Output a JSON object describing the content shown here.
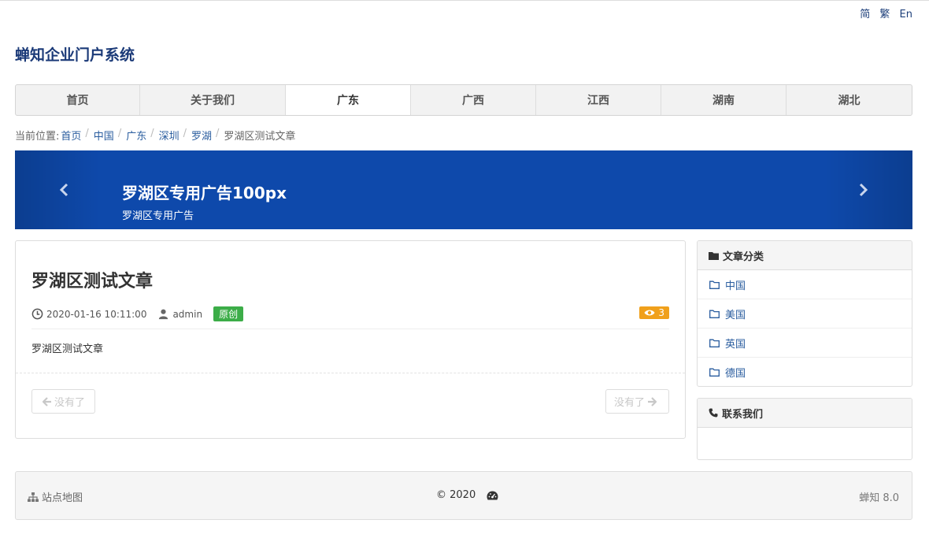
{
  "lang": {
    "simplified": "简",
    "traditional": "繁",
    "english": "En"
  },
  "site": {
    "title": "蝉知企业门户系统"
  },
  "nav": {
    "items": [
      {
        "label": "首页"
      },
      {
        "label": "关于我们"
      },
      {
        "label": "广东",
        "active": true
      },
      {
        "label": "广西"
      },
      {
        "label": "江西"
      },
      {
        "label": "湖南"
      },
      {
        "label": "湖北"
      }
    ]
  },
  "breadcrumb": {
    "prefix": "当前位置:",
    "items": [
      "首页",
      "中国",
      "广东",
      "深圳",
      "罗湖"
    ],
    "current": "罗湖区测试文章"
  },
  "banner": {
    "title": "罗湖区专用广告100px",
    "subtitle": "罗湖区专用广告",
    "bg_color": "#0e49ab",
    "prev_icon": "chevron-left-icon",
    "next_icon": "chevron-right-icon"
  },
  "article": {
    "title": "罗湖区测试文章",
    "date": "2020-01-16 10:11:00",
    "author": "admin",
    "type_badge": "原创",
    "views": "3",
    "body": "罗湖区测试文章",
    "prev_label": "没有了",
    "next_label": "没有了"
  },
  "sidebar": {
    "categories": {
      "title": "文章分类",
      "items": [
        "中国",
        "美国",
        "英国",
        "德国"
      ]
    },
    "contact": {
      "title": "联系我们"
    }
  },
  "footer": {
    "sitemap": "站点地图",
    "copyright": "© 2020",
    "version": "蝉知 8.0"
  },
  "colors": {
    "brand": "#1b3a78",
    "link": "#2a5d9f",
    "badge_original": "#3cad48",
    "badge_views": "#f0a01b"
  }
}
